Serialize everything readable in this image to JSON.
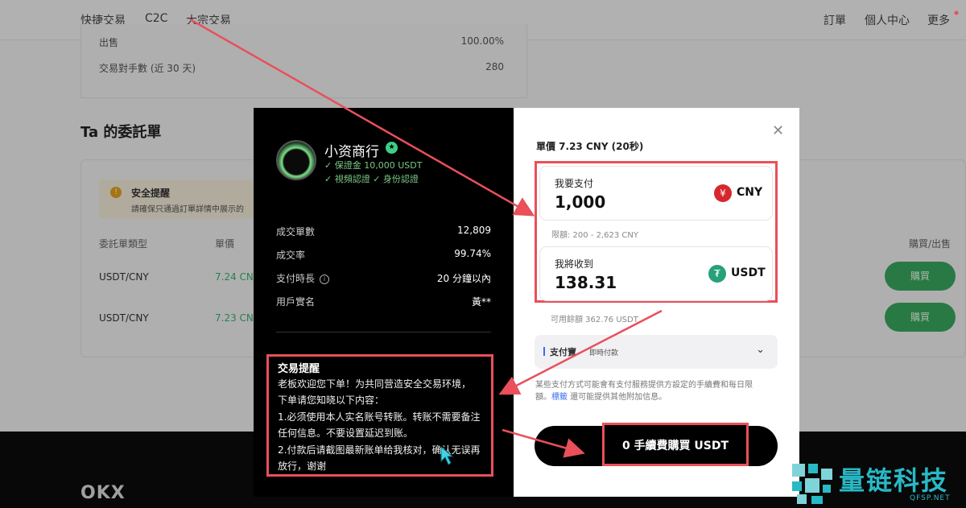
{
  "nav": {
    "items": [
      "快捷交易",
      "C2C",
      "大宗交易"
    ],
    "right": [
      "訂單",
      "個人中心",
      "更多"
    ]
  },
  "stats": {
    "row1_label": "出售",
    "row1_value": "100.00%",
    "row2_label": "交易對手數 (近 30 天)",
    "row2_value": "280"
  },
  "section_title": "Ta 的委託單",
  "safety": {
    "title": "安全提醒",
    "text": "請確保只通過訂單詳情中展示的"
  },
  "orders": {
    "headers": [
      "委託單類型",
      "單價",
      "購買/出售"
    ],
    "rows": [
      {
        "pair": "USDT/CNY",
        "price": "7.24 CN",
        "action": "購買"
      },
      {
        "pair": "USDT/CNY",
        "price": "7.23 CN",
        "action": "購買"
      }
    ]
  },
  "footer_logo": "OKX",
  "merchant": {
    "name": "小资商行",
    "badges": [
      "✓ 保證金 10,000 USDT",
      "✓ 視頻認證  ✓ 身份認證"
    ],
    "info": [
      {
        "label": "成交單數",
        "value": "12,809"
      },
      {
        "label": "成交率",
        "value": "99.74%"
      },
      {
        "label": "支付時長",
        "value": "20 分鐘以內"
      },
      {
        "label": "用戶實名",
        "value": "黃**"
      }
    ]
  },
  "notice": {
    "title": "交易提醒",
    "lines": [
      "老板欢迎您下单！为共同营造安全交易环境，",
      "下单请您知晓以下内容：",
      "1.必须使用本人实名账号转账。转账不需要备注",
      "任何信息。不要设置延迟到账。",
      "2.付款后请截图最新账单给我核对，确认无误再",
      "放行，谢谢"
    ]
  },
  "trade": {
    "unit_price": "單價 7.23 CNY (20秒)",
    "pay_label": "我要支付",
    "pay_value": "1,000",
    "pay_currency": "CNY",
    "pay_currency_symbol": "¥",
    "limit": "限額: 200 - 2,623 CNY",
    "receive_label": "我將收到",
    "receive_value": "138.31",
    "receive_currency": "USDT",
    "balance": "可用餘額 362.76 USDT",
    "pay_method": "支付寶",
    "pay_method_sub": "即時付款",
    "disclaimer_1": "某些支付方式可能會有支付服務提供方設定的手續費和每日限",
    "disclaimer_2a": "額。",
    "disclaimer_link": "標籤",
    "disclaimer_2b": " 還可能提供其他附加信息。",
    "buy_button": "0 手續費購買 USDT",
    "close": "✕"
  },
  "colors": {
    "accent_red": "#e9505a",
    "green": "#3aa860",
    "cny": "#d6272f",
    "usdt": "#26a17b"
  },
  "watermark": {
    "title": "量链科技",
    "sub": "QFSP.NET"
  }
}
